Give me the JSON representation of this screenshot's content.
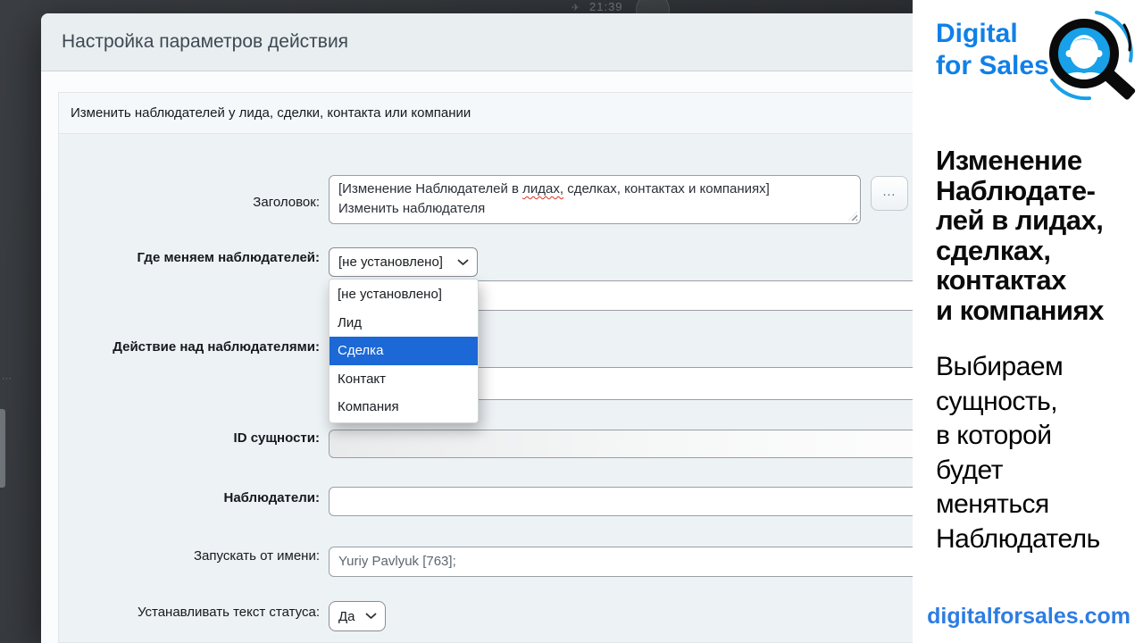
{
  "taskbar": {
    "clock": "21:39"
  },
  "window": {
    "title": "Настройка параметров действия"
  },
  "panel": {
    "header": "Изменить наблюдателей у лида, сделки, контакта или компании"
  },
  "form": {
    "title": {
      "label": "Заголовок:",
      "value_before": "[Изменение Наблюдателей в ",
      "value_misspelled": "лидах,",
      "value_after": " сделках, контактах и компаниях]",
      "value_line2": "Изменить наблюдателя",
      "more_button": "..."
    },
    "entity": {
      "label": "Где меняем наблюдателей:",
      "value": "[не установлено]"
    },
    "action": {
      "label": "Действие над наблюдателями:"
    },
    "entity_id": {
      "label": "ID сущности:",
      "value": ""
    },
    "observers": {
      "label": "Наблюдатели:",
      "value": ""
    },
    "run_as": {
      "label": "Запускать от имени:",
      "value": "Yuriy Pavlyuk [763];"
    },
    "status_text": {
      "label": "Устанавливать текст статуса:",
      "value": "Да"
    }
  },
  "dropdown": {
    "options": [
      {
        "label": "[не установлено]",
        "selected": false
      },
      {
        "label": "Лид",
        "selected": false
      },
      {
        "label": "Сделка",
        "selected": true
      },
      {
        "label": "Контакт",
        "selected": false
      },
      {
        "label": "Компания",
        "selected": false
      }
    ]
  },
  "sidebar": {
    "brand": "Digital\nfor Sales",
    "heading": "Изменение\nНаблюдате-\nлей в лидах,\nсделках,\nконтактах\nи компаниях",
    "subtext": "Выбираем\nсущность,\nв которой\nбудет\nменяться\nНаблюдатель",
    "site": "digitalforsales.com"
  },
  "colors": {
    "selection_blue": "#1c68d6",
    "brand_blue": "#1080e8",
    "site_blue": "#2d7ce3",
    "logo_blue": "#18a0e8",
    "dialog_header": "#e9eef1",
    "form_background": "#edf2f5"
  }
}
